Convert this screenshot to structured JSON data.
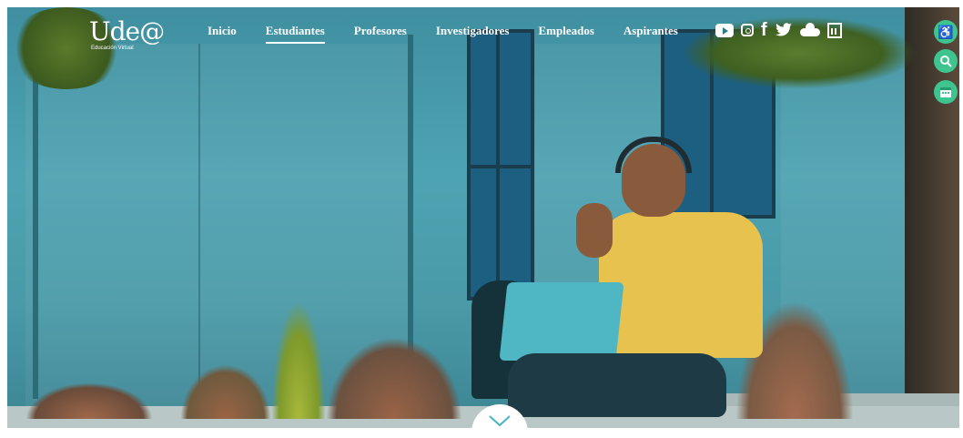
{
  "logo": {
    "title": "Ude@",
    "subtitle": "Educación Virtual"
  },
  "nav": {
    "items": [
      {
        "label": "Inicio"
      },
      {
        "label": "Estudiantes",
        "active": true
      },
      {
        "label": "Profesores"
      },
      {
        "label": "Investigadores"
      },
      {
        "label": "Empleados"
      },
      {
        "label": "Aspirantes"
      }
    ]
  },
  "social_icons": [
    "youtube-icon",
    "instagram-icon",
    "facebook-icon",
    "twitter-icon",
    "soundcloud-icon",
    "calendar-news-icon"
  ],
  "side_buttons": [
    "accessibility-icon",
    "search-icon",
    "calendar-icon"
  ],
  "colors": {
    "accent": "#3ec48e",
    "nav_text": "#ffffff"
  }
}
